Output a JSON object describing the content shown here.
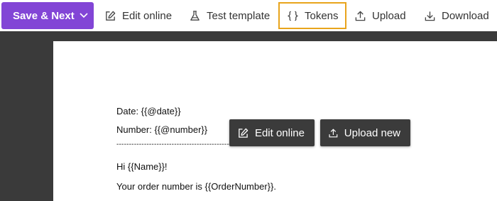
{
  "toolbar": {
    "save_next_label": "Save & Next",
    "edit_online_label": "Edit online",
    "test_template_label": "Test template",
    "tokens_label": "Tokens",
    "upload_label": "Upload",
    "download_label": "Download",
    "accent_color": "#8245d6",
    "highlight_color": "#e8a41c"
  },
  "document": {
    "lines": [
      "Date: {{@date}}",
      "Number: {{@number}}",
      "--------------------------------------------------",
      "Hi {{Name}}!",
      "Your order number is {{OrderNumber}}."
    ]
  },
  "overlay": {
    "edit_online_label": "Edit online",
    "upload_new_label": "Upload new"
  }
}
